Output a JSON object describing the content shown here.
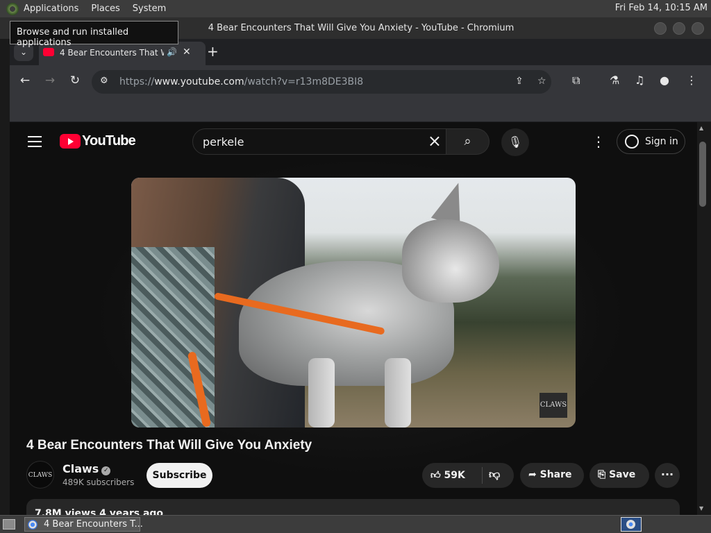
{
  "top_panel": {
    "menus": [
      "Applications",
      "Places",
      "System"
    ],
    "clock": "Fri Feb 14, 10:15 AM"
  },
  "tooltip": "Browse and run installed applications",
  "window": {
    "title": "4 Bear Encounters That Will Give You Anxiety - YouTube - Chromium"
  },
  "tabs": [
    {
      "title": "4 Bear Encounters That Will Give You Anxiety",
      "audio": "🔊",
      "close": "✕"
    }
  ],
  "toolbar": {
    "url_scheme": "https://",
    "url_host": "www.youtube.com",
    "url_path": "/watch?v=r13m8DE3BI8"
  },
  "youtube": {
    "logo": "YouTube",
    "search_value": "perkele",
    "sign_in": "Sign in",
    "video_title": "4 Bear Encounters That Will Give You Anxiety",
    "watermark": "CLAWS",
    "channel": {
      "avatar_text": "CLAWS",
      "name": "Claws",
      "subscribers": "489K subscribers"
    },
    "subscribe_label": "Subscribe",
    "likes": "59K",
    "share_label": "Share",
    "save_label": "Save",
    "description_meta": "7.8M views  4 years ago"
  },
  "taskbar": {
    "window_label": "4 Bear Encounters T..."
  },
  "colors": {
    "brand": "#ff0033",
    "page_bg": "#0f0f0f",
    "pill_bg": "#272727"
  }
}
